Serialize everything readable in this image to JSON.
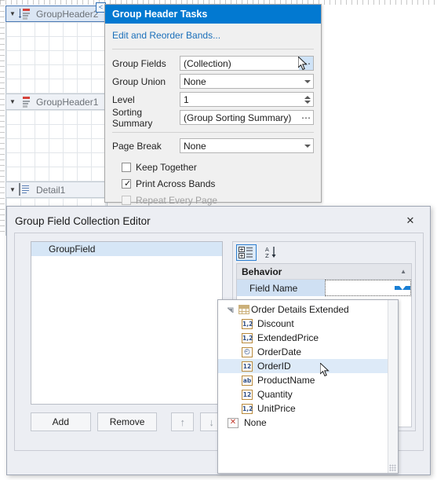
{
  "designer": {
    "bands": [
      {
        "label": "GroupHeader2",
        "icon": "group-header-icon",
        "selected": true
      },
      {
        "label": "GroupHeader1",
        "icon": "group-header-icon",
        "selected": false
      },
      {
        "label": "Detail1",
        "icon": "detail-band-icon",
        "selected": false
      }
    ],
    "collapse_button": "<"
  },
  "tasks_panel": {
    "title": "Group Header Tasks",
    "edit_link": "Edit and Reorder Bands...",
    "properties": [
      {
        "label": "Group Fields",
        "value": "(Collection)",
        "editor": "ellipsis"
      },
      {
        "label": "Group Union",
        "value": "None",
        "editor": "dropdown"
      },
      {
        "label": "Level",
        "value": "1",
        "editor": "spin"
      },
      {
        "label": "Sorting Summary",
        "value": "(Group Sorting Summary)",
        "editor": "ellipsis-plain"
      },
      {
        "label": "Page Break",
        "value": "None",
        "editor": "dropdown"
      }
    ],
    "checkboxes": [
      {
        "label": "Keep Together",
        "checked": false,
        "disabled": false
      },
      {
        "label": "Print Across Bands",
        "checked": true,
        "disabled": false
      },
      {
        "label": "Repeat Every Page",
        "checked": false,
        "disabled": true
      }
    ]
  },
  "dialog": {
    "title": "Group Field Collection Editor",
    "close_label": "✕",
    "members": [
      {
        "label": "GroupField",
        "selected": true
      }
    ],
    "buttons": {
      "add": "Add",
      "remove": "Remove",
      "move_up": "↑",
      "move_down": "↓"
    },
    "property_grid": {
      "toolbar": [
        {
          "name": "categorized-button",
          "active": true
        },
        {
          "name": "alphabetical-sort-button",
          "active": false
        }
      ],
      "category": "Behavior",
      "rows": [
        {
          "name": "Field Name",
          "value": "",
          "selected": true,
          "editor": "dropdown"
        }
      ]
    },
    "dropdown": {
      "items": [
        {
          "label": "Order Details Extended",
          "icon": "table-icon",
          "level": 0,
          "expanded": true,
          "highlighted": false
        },
        {
          "label": "Discount",
          "icon": "decimal-field-icon",
          "icon_text": "1,2",
          "level": 1,
          "highlighted": false
        },
        {
          "label": "ExtendedPrice",
          "icon": "decimal-field-icon",
          "icon_text": "1,2",
          "level": 1,
          "highlighted": false
        },
        {
          "label": "OrderDate",
          "icon": "date-field-icon",
          "icon_text": "◴",
          "level": 1,
          "highlighted": false
        },
        {
          "label": "OrderID",
          "icon": "integer-field-icon",
          "icon_text": "12",
          "level": 1,
          "highlighted": true
        },
        {
          "label": "ProductName",
          "icon": "text-field-icon",
          "icon_text": "ab",
          "level": 1,
          "highlighted": false
        },
        {
          "label": "Quantity",
          "icon": "integer-field-icon",
          "icon_text": "12",
          "level": 1,
          "highlighted": false
        },
        {
          "label": "UnitPrice",
          "icon": "decimal-field-icon",
          "icon_text": "1,2",
          "level": 1,
          "highlighted": false
        },
        {
          "label": "None",
          "icon": "none-field-icon",
          "icon_text": "✕",
          "level": 0,
          "highlighted": false
        }
      ]
    }
  },
  "colors": {
    "accent_blue": "#0279d1",
    "selection_blue": "#cfe0f3",
    "highlight_blue": "#ddeaf8",
    "link_blue": "#1a6fba",
    "dialog_bg": "#eceef3"
  }
}
